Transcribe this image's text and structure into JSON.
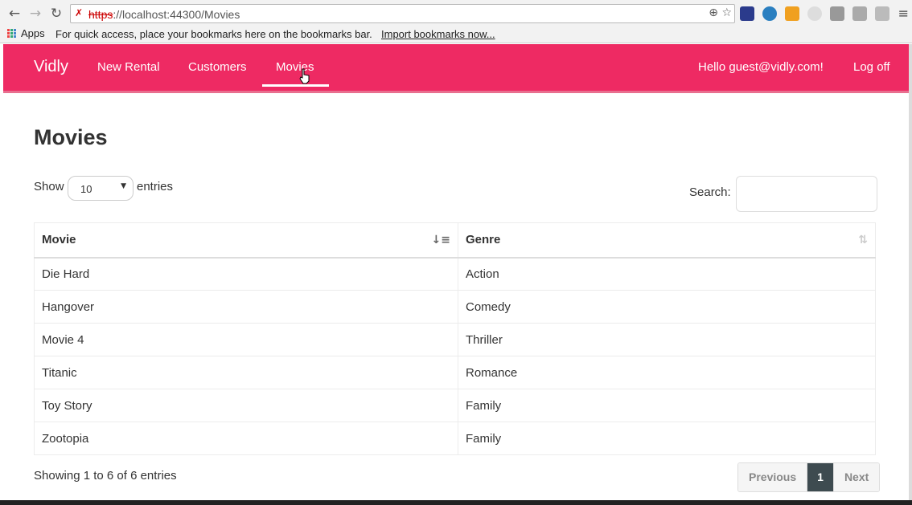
{
  "browser": {
    "url_scheme": "https",
    "url_rest": "://localhost:44300/Movies",
    "bookmarks_apps": "Apps",
    "bookmarks_hint": "For quick access, place your bookmarks here on the bookmarks bar.",
    "bookmarks_import": "Import bookmarks now..."
  },
  "navbar": {
    "brand": "Vidly",
    "links": [
      "New Rental",
      "Customers",
      "Movies"
    ],
    "active": "Movies",
    "greeting": "Hello guest@vidly.com!",
    "logoff": "Log off",
    "color": "#ee2a63"
  },
  "page": {
    "title": "Movies",
    "show_label": "Show",
    "page_size": "10",
    "entries_label": "entries",
    "search_label": "Search:",
    "search_value": ""
  },
  "table": {
    "columns": [
      "Movie",
      "Genre"
    ],
    "rows": [
      [
        "Die Hard",
        "Action"
      ],
      [
        "Hangover",
        "Comedy"
      ],
      [
        "Movie 4",
        "Thriller"
      ],
      [
        "Titanic",
        "Romance"
      ],
      [
        "Toy Story",
        "Family"
      ],
      [
        "Zootopia",
        "Family"
      ]
    ]
  },
  "footer": {
    "info": "Showing 1 to 6 of 6 entries",
    "previous": "Previous",
    "current_page": "1",
    "next": "Next"
  }
}
